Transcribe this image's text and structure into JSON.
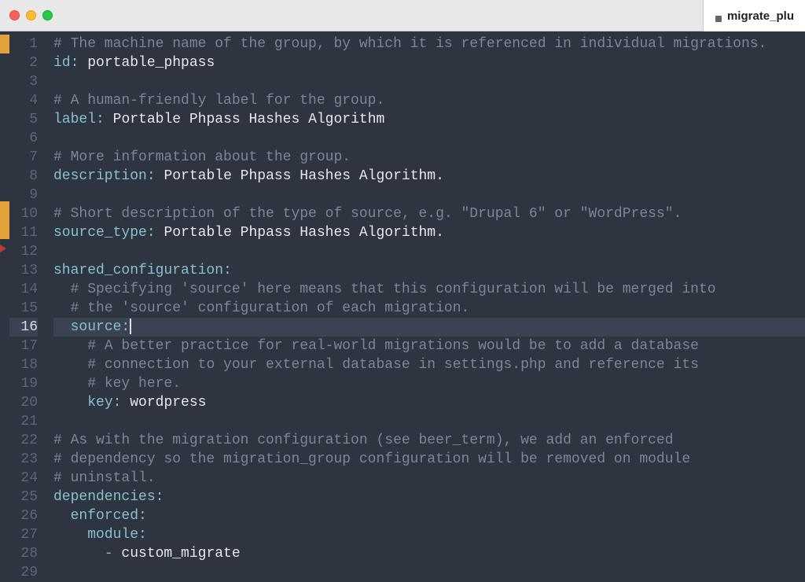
{
  "window": {
    "tab_filename": "migrate_plu"
  },
  "code": {
    "current_line": 16,
    "lines": [
      {
        "n": 1,
        "indent": 0,
        "type": "comment",
        "text": "# The machine name of the group, by which it is referenced in individual migrations.",
        "marker": "orange"
      },
      {
        "n": 2,
        "indent": 0,
        "type": "kv",
        "key": "id",
        "value": "portable_phpass"
      },
      {
        "n": 3,
        "indent": 0,
        "type": "blank"
      },
      {
        "n": 4,
        "indent": 0,
        "type": "comment",
        "text": "# A human-friendly label for the group."
      },
      {
        "n": 5,
        "indent": 0,
        "type": "kv",
        "key": "label",
        "value": "Portable Phpass Hashes Algorithm"
      },
      {
        "n": 6,
        "indent": 0,
        "type": "blank"
      },
      {
        "n": 7,
        "indent": 0,
        "type": "comment",
        "text": "# More information about the group."
      },
      {
        "n": 8,
        "indent": 0,
        "type": "kv",
        "key": "description",
        "value": "Portable Phpass Hashes Algorithm."
      },
      {
        "n": 9,
        "indent": 0,
        "type": "blank"
      },
      {
        "n": 10,
        "indent": 0,
        "type": "comment",
        "text": "# Short description of the type of source, e.g. \"Drupal 6\" or \"WordPress\".",
        "marker": "orange"
      },
      {
        "n": 11,
        "indent": 0,
        "type": "kv",
        "key": "source_type",
        "value": "Portable Phpass Hashes Algorithm.",
        "marker": "orange"
      },
      {
        "n": 12,
        "indent": 0,
        "type": "blank",
        "marker": "red-arrow"
      },
      {
        "n": 13,
        "indent": 0,
        "type": "key",
        "key": "shared_configuration"
      },
      {
        "n": 14,
        "indent": 1,
        "type": "comment",
        "text": "# Specifying 'source' here means that this configuration will be merged into"
      },
      {
        "n": 15,
        "indent": 1,
        "type": "comment",
        "text": "# the 'source' configuration of each migration."
      },
      {
        "n": 16,
        "indent": 1,
        "type": "key",
        "key": "source",
        "cursor": true
      },
      {
        "n": 17,
        "indent": 2,
        "type": "comment",
        "text": "# A better practice for real-world migrations would be to add a database"
      },
      {
        "n": 18,
        "indent": 2,
        "type": "comment",
        "text": "# connection to your external database in settings.php and reference its"
      },
      {
        "n": 19,
        "indent": 2,
        "type": "comment",
        "text": "# key here."
      },
      {
        "n": 20,
        "indent": 2,
        "type": "kv",
        "key": "key",
        "value": "wordpress"
      },
      {
        "n": 21,
        "indent": 0,
        "type": "blank"
      },
      {
        "n": 22,
        "indent": 0,
        "type": "comment",
        "text": "# As with the migration configuration (see beer_term), we add an enforced"
      },
      {
        "n": 23,
        "indent": 0,
        "type": "comment",
        "text": "# dependency so the migration_group configuration will be removed on module"
      },
      {
        "n": 24,
        "indent": 0,
        "type": "comment",
        "text": "# uninstall."
      },
      {
        "n": 25,
        "indent": 0,
        "type": "key",
        "key": "dependencies"
      },
      {
        "n": 26,
        "indent": 1,
        "type": "key",
        "key": "enforced"
      },
      {
        "n": 27,
        "indent": 2,
        "type": "key",
        "key": "module"
      },
      {
        "n": 28,
        "indent": 3,
        "type": "list",
        "value": "custom_migrate"
      },
      {
        "n": 29,
        "indent": 0,
        "type": "blank"
      }
    ]
  }
}
